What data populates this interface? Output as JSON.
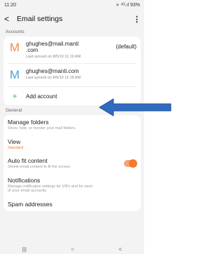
{
  "status": {
    "time": "11:20",
    "indicators": "⋄ ⁴ᴳ.ıl 93%"
  },
  "app_bar": {
    "back": "<",
    "title": "Email settings",
    "more": "⋮"
  },
  "accounts": {
    "header": "Accounts",
    "items": [
      {
        "letter": "M",
        "email": "ghughes@mail.manti\n.com",
        "synced": "Last synced on 8/5/19 11:19 AM",
        "default_label": "(default)",
        "letter_color": "#f08a4b"
      },
      {
        "letter": "M",
        "email": "ghughes@manti.com",
        "synced": "Last synced on 8/5/19 11:18 AM",
        "letter_color": "#4aa3df"
      }
    ],
    "add": {
      "icon": "+",
      "label": "Add account"
    }
  },
  "general": {
    "header": "General",
    "items": [
      {
        "title": "Manage folders",
        "subtitle": "Show, hide, or reorder your mail folders."
      },
      {
        "title": "View",
        "subtitle": "Standard"
      },
      {
        "title": "Auto fit content",
        "subtitle": "Shrink email content to fit the screen.",
        "toggle_on": true
      },
      {
        "title": "Notifications",
        "subtitle": "Manage notification settings for VIPs and for each\nof your email accounts."
      },
      {
        "title": "Spam addresses",
        "subtitle": ""
      }
    ]
  },
  "nav": {
    "recents": "|||",
    "home": "○",
    "back": "<"
  },
  "colors": {
    "accent": "#f07a2c",
    "arrow": "#2f6cc0",
    "add_icon": "#4caf50"
  }
}
